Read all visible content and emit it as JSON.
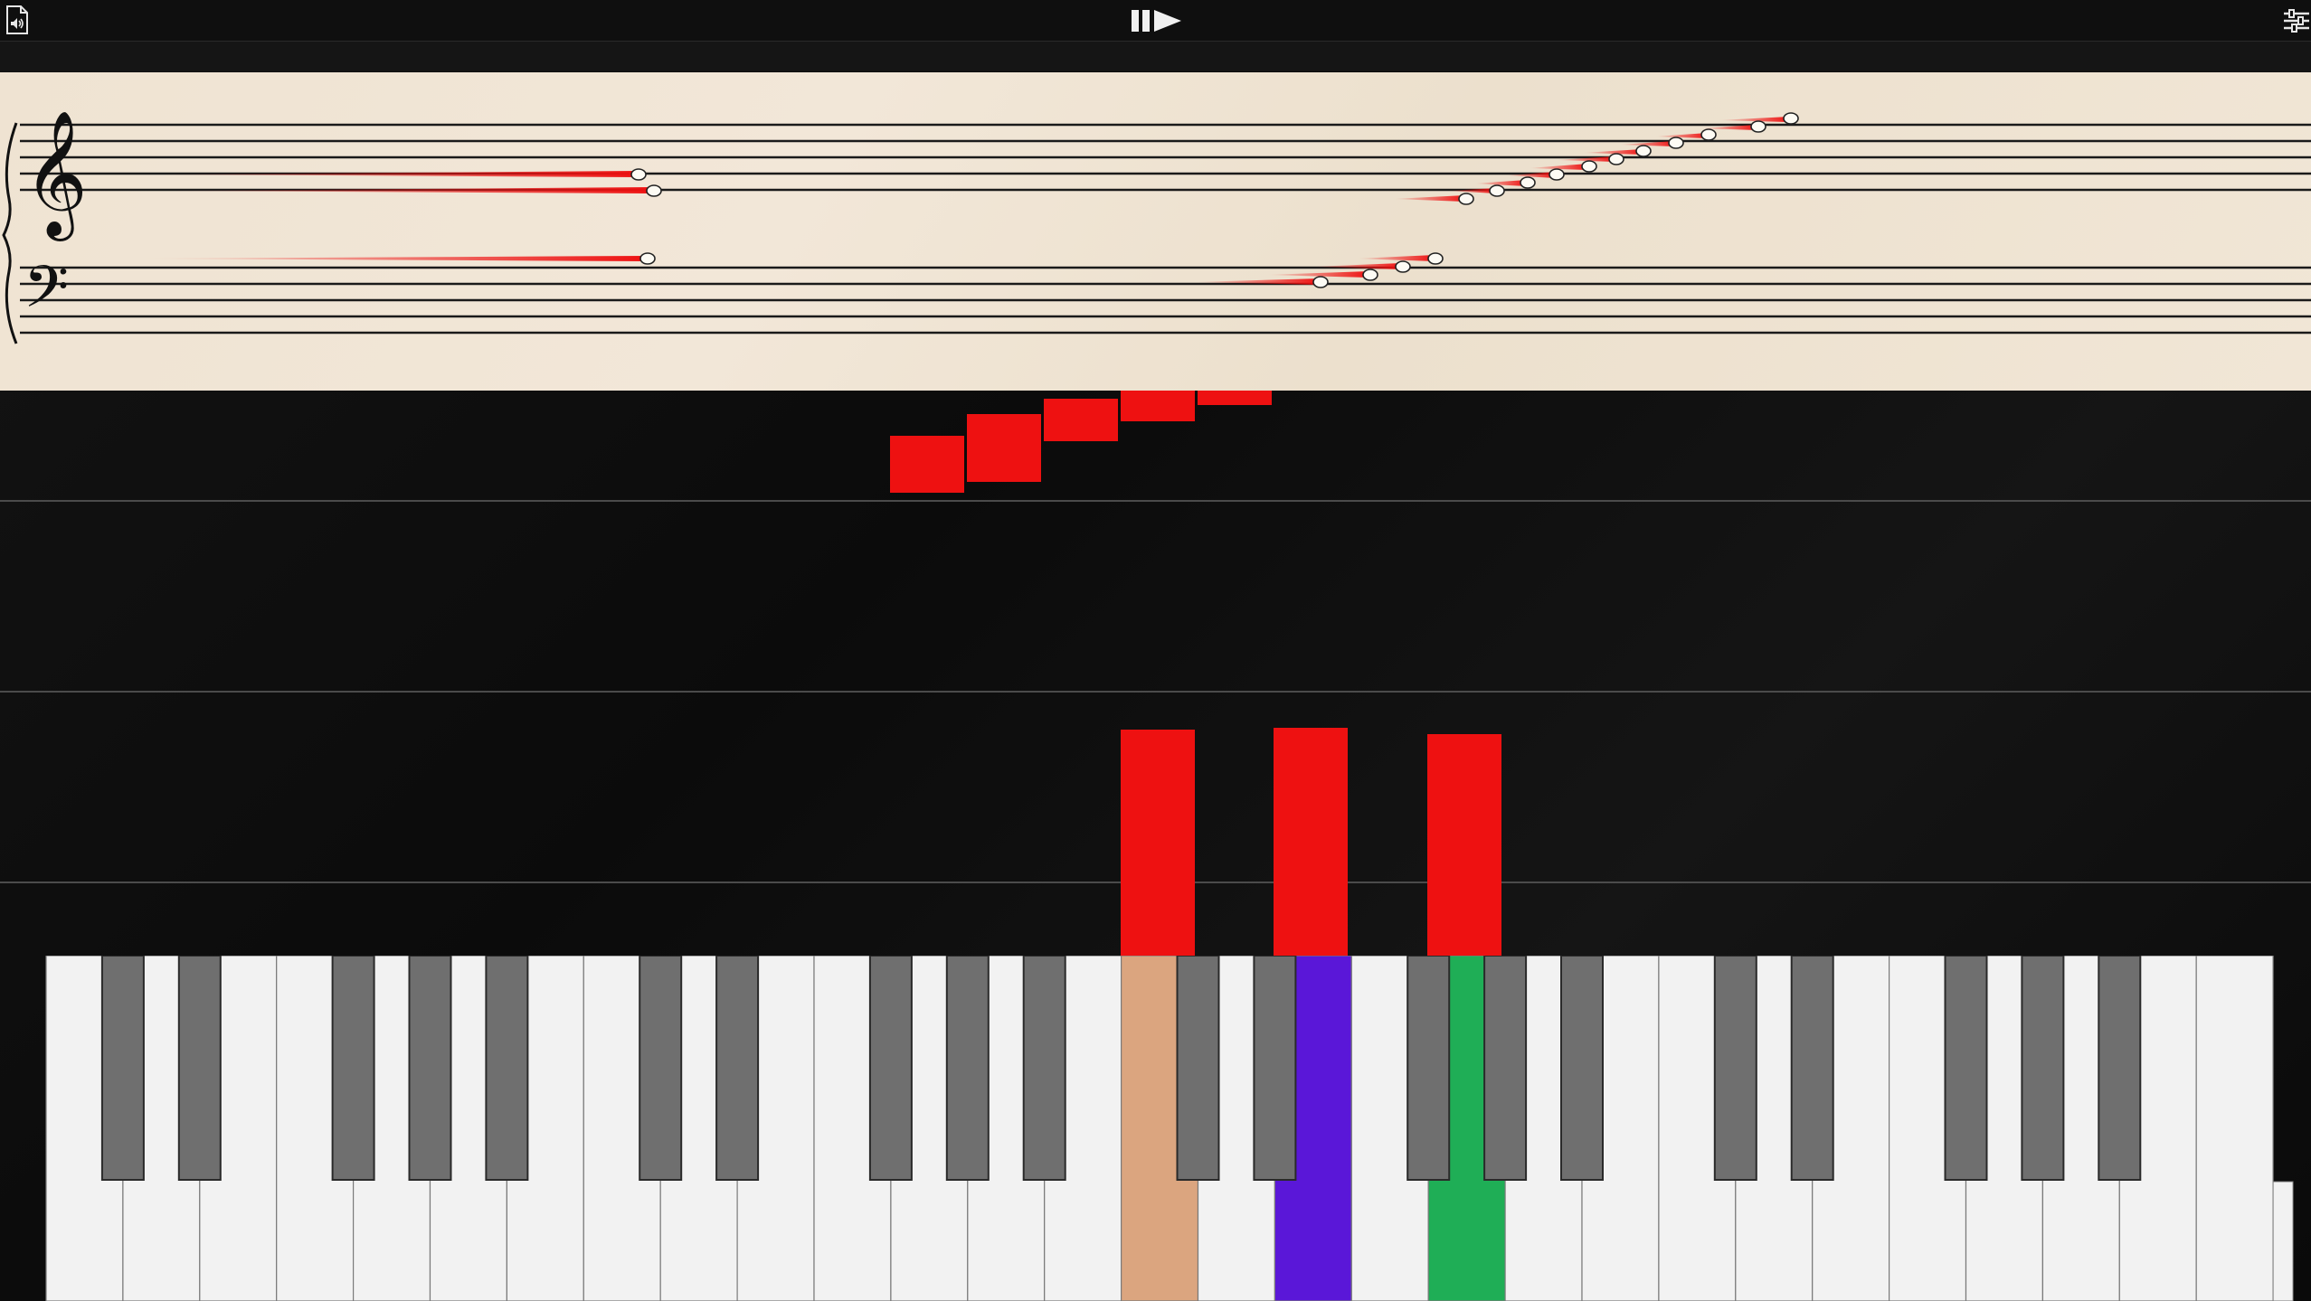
{
  "toolbar": {
    "file_icon": "sound-file-icon",
    "play_icon": "pause-play-icon",
    "settings_icon": "mixer-sliders-icon",
    "play_glyph": "▮▮▶"
  },
  "score": {
    "clefs": [
      "treble-clef",
      "bass-clef"
    ],
    "treble_clef_glyph": "𝄞",
    "bass_clef_glyph": "𝄢"
  },
  "colors": {
    "note_trail": "#ee1111",
    "falling_note": "#ee1111",
    "key_pressed_1": "#dba57f",
    "key_pressed_2": "#5a17d8",
    "key_pressed_3": "#1fae56",
    "black_key": "#6f6f6f",
    "white_key": "#f2f2f2",
    "staff_paper": "#efe4d4"
  },
  "keyboard": {
    "pressed_keys": [
      "orange",
      "purple",
      "green"
    ]
  }
}
